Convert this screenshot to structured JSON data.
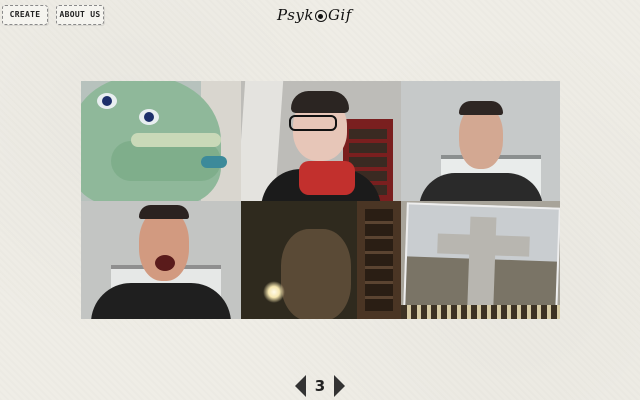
{
  "nav": {
    "create_label": "CREATE",
    "about_label": "ABOUT US"
  },
  "logo": {
    "text_before": "Psyk",
    "text_after": "Gif",
    "icon": "eye-icon"
  },
  "gallery": {
    "frames": [
      {
        "name": "frame-puppet"
      },
      {
        "name": "frame-woman-glasses"
      },
      {
        "name": "frame-man-neutral"
      },
      {
        "name": "frame-man-shouting"
      },
      {
        "name": "frame-dark-room-light"
      },
      {
        "name": "frame-cross-photo"
      }
    ]
  },
  "pager": {
    "current_page": "3",
    "prev_icon": "chevron-left-icon",
    "next_icon": "chevron-right-icon"
  },
  "colors": {
    "background": "#efede6",
    "ink": "#222222"
  }
}
